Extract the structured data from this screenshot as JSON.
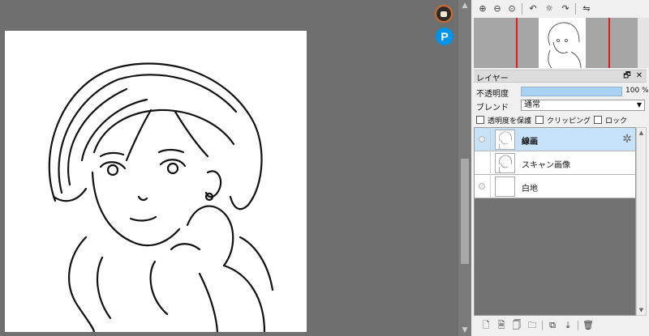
{
  "navigator": {
    "toolbar_icons": [
      "zoom-in-icon",
      "zoom-out-icon",
      "zoom-reset-icon",
      "rotate-left-icon",
      "rotate-reset-icon",
      "rotate-right-icon",
      "flip-icon"
    ],
    "toolbar_glyphs": [
      "⊕",
      "⊖",
      "⊙",
      "↶",
      "☼",
      "↷",
      "⇋"
    ]
  },
  "layer_panel": {
    "title": "レイヤー",
    "float_glyph": "🗗",
    "close_glyph": "✕",
    "opacity": {
      "label": "不透明度",
      "value_text": "100 %",
      "value": 1.0
    },
    "blend": {
      "label": "ブレンド",
      "selected": "通常",
      "arrow": "▼"
    },
    "checkboxes": [
      {
        "label": "透明度を保護",
        "checked": false
      },
      {
        "label": "クリッピング",
        "checked": false
      },
      {
        "label": "ロック",
        "checked": false
      }
    ],
    "layers": [
      {
        "name": "線画",
        "selected": true
      },
      {
        "name": "スキャン画像",
        "selected": false
      },
      {
        "name": "白地",
        "selected": false
      }
    ],
    "gear_glyph": "✲",
    "scroll_up": "▲",
    "scroll_down": "▼"
  },
  "bottom_toolbar": {
    "glyphs": [
      "🗋",
      "🗎",
      "🗍",
      "🗀",
      "⧉",
      "⤓",
      "🗑"
    ],
    "icons": [
      "new-layer-icon",
      "new-halftone-layer-icon",
      "new-8bit-layer-icon",
      "new-folder-icon",
      "duplicate-layer-icon",
      "merge-down-icon",
      "delete-layer-icon"
    ]
  },
  "side": {
    "p_badge": "P"
  },
  "scroll": {
    "up": "▲",
    "down": "▼"
  },
  "colors": {
    "workspace": "#6f6f6f",
    "selected_layer": "#c6e2f8",
    "opacity_fill": "#a9d1f2",
    "preview_marker": "#e01b1b"
  }
}
